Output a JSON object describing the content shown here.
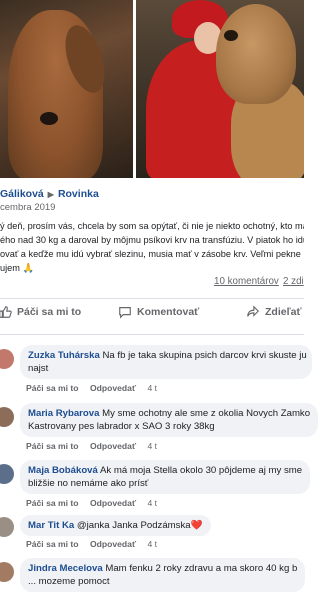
{
  "post": {
    "author": "Gáliková",
    "group": "Rovinka",
    "date": "cembra 2019",
    "text_lines": [
      "ý deň, prosím vás, chcela by som sa opýtať, či nie je niekto ochotný, kto má p",
      "ého nad 30 kg a daroval by môjmu psíkovi krv na transfúziu. V piatok ho idú",
      "ovať a keďže mu idú vybrať slezinu, musia mať v zásobe krv. Veľmi pekne",
      "ujem 🙏"
    ],
    "comments_count": "10 komentárov",
    "shares_count": "2 zdi"
  },
  "actions": {
    "like": "Páči sa mi to",
    "comment": "Komentovať",
    "share": "Zdieľať"
  },
  "comments": [
    {
      "name": "Zuzka Tuhárska",
      "lines": [
        "Na fb je taka skupina psich darcov krvi skuste ju",
        "najst"
      ],
      "like_label": "Páči sa mi to",
      "reply_label": "Odpovedať",
      "time": "4 t"
    },
    {
      "name": "Maria Rybarova",
      "lines": [
        "My sme ochotny ale sme z okolia Novych Zamko",
        "Kastrovany pes labrador x SAO 3 roky 38kg"
      ],
      "like_label": "Páči sa mi to",
      "reply_label": "Odpovedať",
      "time": "4 t"
    },
    {
      "name": "Maja Bobáková",
      "lines": [
        "Ak má moja Stella okolo 30 pôjdeme aj my sme",
        "bližšie no nemáme ako prísť"
      ],
      "like_label": "Páči sa mi to",
      "reply_label": "Odpovedať",
      "time": "4 t"
    },
    {
      "name": "Mar Tit Ka",
      "lines": [
        "@janka Janka Podzámska❤️"
      ],
      "like_label": "Páči sa mi to",
      "reply_label": "Odpovedať",
      "time": "4 t"
    },
    {
      "name": "Jindra Mecelova",
      "lines": [
        "Mam fenku 2 roky zdravu a ma skoro 40 kg b",
        "... mozeme pomoct"
      ],
      "like_label": "",
      "reply_label": "",
      "time": ""
    }
  ],
  "colors": {
    "link_blue": "#1d4d91",
    "muted": "#65676b",
    "bubble_bg": "#f0f2f5",
    "heart": "#e41e3f"
  }
}
